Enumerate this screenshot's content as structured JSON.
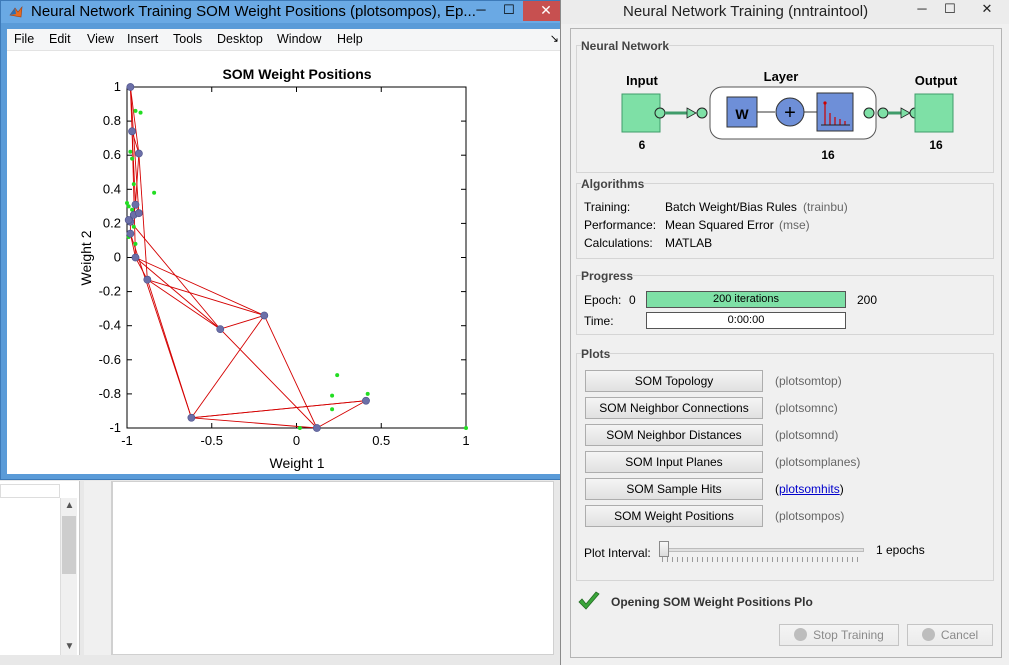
{
  "figure_window": {
    "title": "Neural Network Training SOM Weight Positions (plotsompos), Ep...",
    "controls": {
      "minimize": "─",
      "maximize": "☐",
      "close": "✕"
    },
    "menu": [
      "File",
      "Edit",
      "View",
      "Insert",
      "Tools",
      "Desktop",
      "Window",
      "Help"
    ],
    "dock_glyph": "↘"
  },
  "chart_data": {
    "type": "scatter",
    "title": "SOM Weight Positions",
    "xlabel": "Weight 1",
    "ylabel": "Weight 2",
    "xlim": [
      -1,
      1
    ],
    "ylim": [
      -1,
      1
    ],
    "xticks": [
      "-1",
      "-0.5",
      "0",
      "0.5",
      "1"
    ],
    "yticks": [
      "1",
      "0.8",
      "0.6",
      "0.4",
      "0.2",
      "0",
      "-0.2",
      "-0.4",
      "-0.6",
      "-0.8",
      "-1"
    ],
    "neuron_color": "#6b6fa8",
    "edge_color": "#d40000",
    "input_color": "#22dd22",
    "neurons": [
      [
        -0.98,
        1.0
      ],
      [
        -0.97,
        0.74
      ],
      [
        -0.93,
        0.61
      ],
      [
        -0.95,
        0.31
      ],
      [
        -0.96,
        0.25
      ],
      [
        -0.98,
        0.21
      ],
      [
        -0.98,
        0.14
      ],
      [
        -0.95,
        0.0
      ],
      [
        -0.88,
        -0.13
      ],
      [
        -0.45,
        -0.42
      ],
      [
        -0.19,
        -0.34
      ],
      [
        -0.62,
        -0.94
      ],
      [
        0.12,
        -1.0
      ],
      [
        0.41,
        -0.84
      ],
      [
        -0.93,
        0.26
      ],
      [
        -0.99,
        0.22
      ]
    ],
    "edges": [
      [
        0,
        1
      ],
      [
        1,
        2
      ],
      [
        2,
        3
      ],
      [
        3,
        4
      ],
      [
        4,
        5
      ],
      [
        5,
        6
      ],
      [
        6,
        7
      ],
      [
        7,
        8
      ],
      [
        0,
        2
      ],
      [
        1,
        3
      ],
      [
        0,
        14
      ],
      [
        14,
        15
      ],
      [
        15,
        5
      ],
      [
        3,
        14
      ],
      [
        4,
        15
      ],
      [
        7,
        10
      ],
      [
        8,
        10
      ],
      [
        8,
        9
      ],
      [
        9,
        10
      ],
      [
        9,
        12
      ],
      [
        10,
        12
      ],
      [
        11,
        12
      ],
      [
        11,
        13
      ],
      [
        12,
        13
      ],
      [
        10,
        11
      ],
      [
        8,
        11
      ],
      [
        6,
        11
      ],
      [
        5,
        9
      ],
      [
        7,
        9
      ],
      [
        13,
        11
      ],
      [
        2,
        8
      ],
      [
        1,
        7
      ]
    ],
    "inputs": [
      [
        -0.98,
        1.0
      ],
      [
        -0.95,
        0.86
      ],
      [
        -0.92,
        0.85
      ],
      [
        -0.98,
        0.62
      ],
      [
        -0.97,
        0.58
      ],
      [
        -0.96,
        0.43
      ],
      [
        -0.84,
        0.38
      ],
      [
        -1.0,
        0.32
      ],
      [
        -0.99,
        0.3
      ],
      [
        -0.97,
        0.28
      ],
      [
        -0.96,
        0.18
      ],
      [
        -0.99,
        0.12
      ],
      [
        -0.95,
        0.08
      ],
      [
        0.24,
        -0.69
      ],
      [
        0.21,
        -0.81
      ],
      [
        0.21,
        -0.89
      ],
      [
        0.42,
        -0.8
      ],
      [
        0.02,
        -1.0
      ],
      [
        1.0,
        -1.0
      ]
    ]
  },
  "nntraintool": {
    "title": "Neural Network Training (nntraintool)",
    "controls": {
      "minimize": "─",
      "maximize": "☐",
      "close": "✕"
    },
    "network": {
      "group_label": "Neural Network",
      "input_label": "Input",
      "input_size": "6",
      "layer_label": "Layer",
      "layer_size": "16",
      "output_label": "Output",
      "output_size": "16",
      "weight_glyph": "W",
      "sum_glyph": "+"
    },
    "algorithms": {
      "group_label": "Algorithms",
      "rows": [
        {
          "key": "Training:",
          "value": "Batch Weight/Bias Rules",
          "code": "(trainbu)"
        },
        {
          "key": "Performance:",
          "value": "Mean Squared Error",
          "code": "(mse)"
        },
        {
          "key": "Calculations:",
          "value": "MATLAB",
          "code": ""
        }
      ]
    },
    "progress": {
      "group_label": "Progress",
      "epoch_label": "Epoch:",
      "epoch_start": "0",
      "epoch_text": "200 iterations",
      "epoch_end": "200",
      "epoch_fraction": 1.0,
      "time_label": "Time:",
      "time_value": "0:00:00"
    },
    "plots": {
      "group_label": "Plots",
      "buttons": [
        {
          "label": "SOM Topology",
          "code": "(plotsomtop)",
          "is_link": false
        },
        {
          "label": "SOM Neighbor Connections",
          "code": "(plotsomnc)",
          "is_link": false
        },
        {
          "label": "SOM Neighbor Distances",
          "code": "(plotsomnd)",
          "is_link": false
        },
        {
          "label": "SOM Input Planes",
          "code": "(plotsomplanes)",
          "is_link": false
        },
        {
          "label": "SOM Sample Hits",
          "code_open": "(",
          "code_link": "plotsomhits",
          "code_close": ")",
          "is_link": true
        },
        {
          "label": "SOM Weight Positions",
          "code": "(plotsompos)",
          "is_link": false
        }
      ],
      "interval_label": "Plot Interval:",
      "interval_value": "1 epochs"
    },
    "status": {
      "text": "Opening SOM Weight Positions Plo"
    },
    "stop_button": "Stop Training",
    "cancel_button": "Cancel",
    "colors": {
      "block_fill": "#7ee0a6",
      "block_border": "#3f9c6a",
      "weight_fill": "#6e8fd8",
      "check_green": "#3aa53a"
    }
  }
}
